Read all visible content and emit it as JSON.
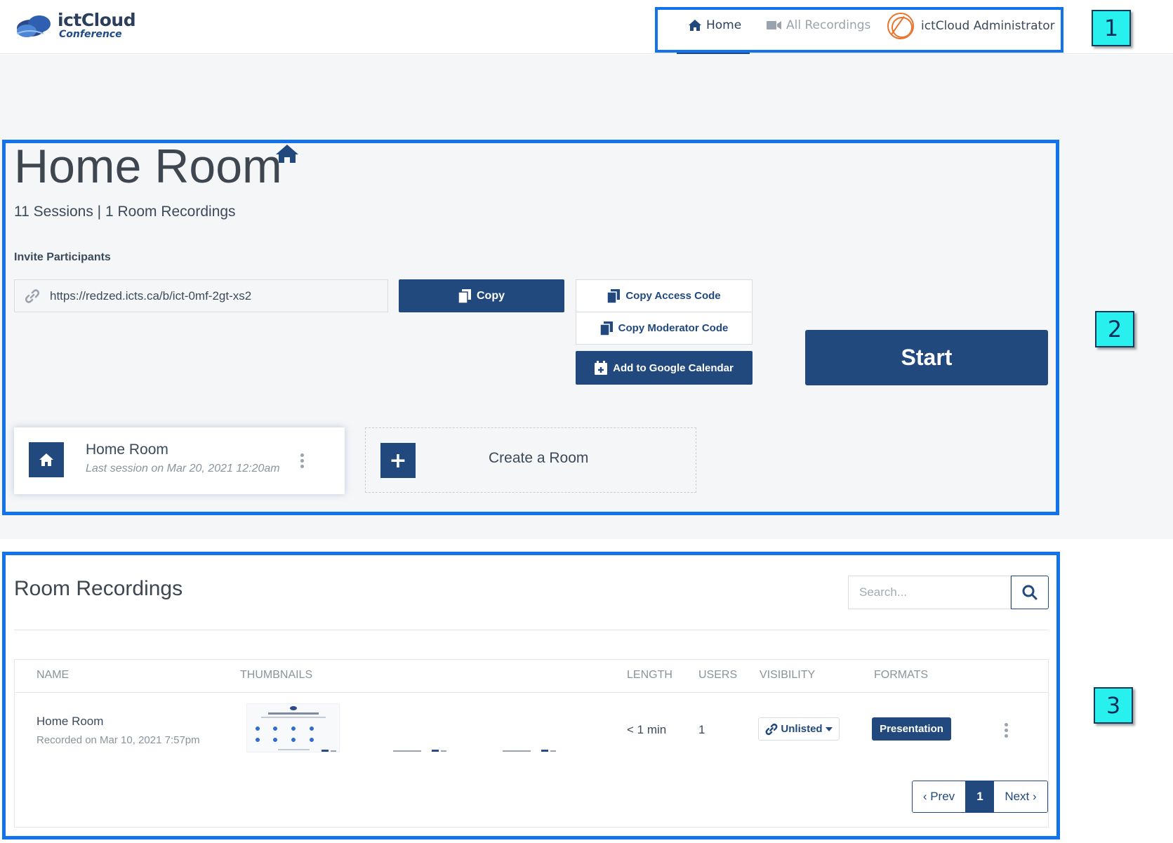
{
  "brand": {
    "name": "ictCloud",
    "subtitle": "Conference"
  },
  "nav": {
    "home": "Home",
    "recordings": "All Recordings",
    "user": "ictCloud Administrator"
  },
  "markers": [
    "1",
    "2",
    "3"
  ],
  "room": {
    "title": "Home Room",
    "stats": "11 Sessions | 1 Room Recordings",
    "invite_label": "Invite Participants",
    "invite_url": "https://redzed.icts.ca/b/ict-0mf-2gt-xs2",
    "copy_label": "Copy",
    "copy_access_label": "Copy Access Code",
    "copy_moderator_label": "Copy Moderator Code",
    "gcal_label": "Add to Google Calendar",
    "start_label": "Start"
  },
  "room_card": {
    "name": "Home Room",
    "last_session": "Last session on Mar 20, 2021 12:20am"
  },
  "create_room": {
    "label": "Create a Room"
  },
  "recordings": {
    "title": "Room Recordings",
    "search_placeholder": "Search...",
    "columns": [
      "NAME",
      "THUMBNAILS",
      "LENGTH",
      "USERS",
      "VISIBILITY",
      "FORMATS"
    ],
    "rows": [
      {
        "name": "Home Room",
        "recorded": "Recorded on Mar 10, 2021 7:57pm",
        "length": "< 1 min",
        "users": "1",
        "visibility": "Unlisted",
        "format": "Presentation"
      }
    ],
    "pagination": {
      "prev": "‹ Prev",
      "current": "1",
      "next": "Next ›"
    }
  },
  "colors": {
    "primary": "#22497d",
    "highlight_box": "#1273eb",
    "marker_bg": "#27f0ef"
  },
  "icons": [
    "home-icon",
    "video-camera-icon",
    "link-icon",
    "copy-icon",
    "calendar-plus-icon",
    "plus-icon",
    "search-icon",
    "kebab-menu-icon",
    "caret-down-icon"
  ]
}
